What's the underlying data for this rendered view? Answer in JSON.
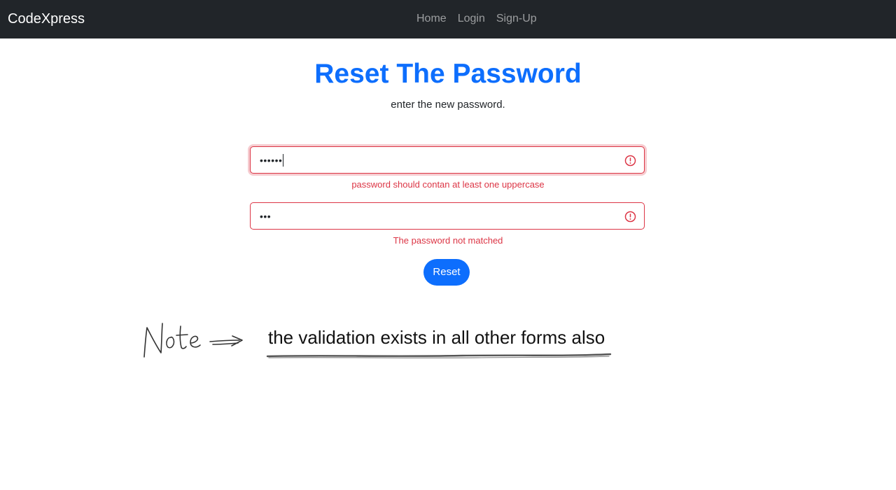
{
  "navbar": {
    "brand": "CodeXpress",
    "links": [
      {
        "label": "Home"
      },
      {
        "label": "Login"
      },
      {
        "label": "Sign-Up"
      }
    ]
  },
  "page": {
    "title": "Reset The Password",
    "subtitle": "enter the new password."
  },
  "form": {
    "password": {
      "masked_value": "••••••",
      "error": "password should contan at least one uppercase",
      "state": "invalid",
      "focused": true
    },
    "confirm_password": {
      "masked_value": "•••",
      "error": "The password not matched",
      "state": "invalid",
      "focused": false
    },
    "submit_label": "Reset"
  },
  "annotation": {
    "handwritten_label": "Note",
    "text": "the validation exists in all other forms also"
  },
  "colors": {
    "navbar_bg": "#212529",
    "primary": "#0d6efd",
    "danger": "#dc3545"
  },
  "icons": {
    "field_status": "exclamation-circle-icon",
    "note_arrow": "arrow-right-icon"
  }
}
